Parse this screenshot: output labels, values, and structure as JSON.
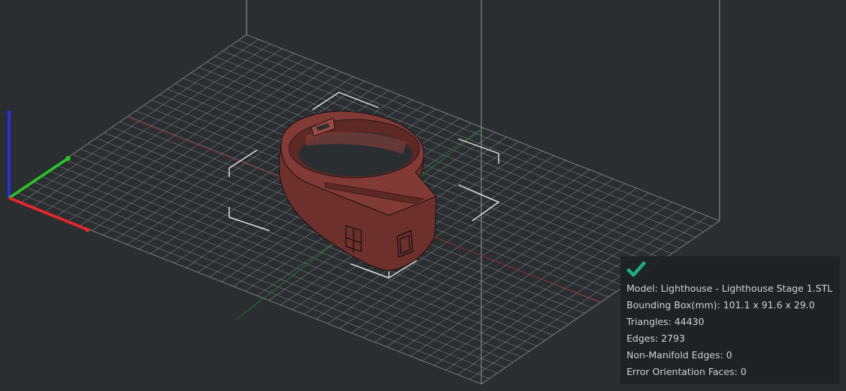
{
  "viewport": {
    "background": "#2b2e31",
    "grid_color": "#8a8d90",
    "model_color": "#7a3733",
    "axis_colors": {
      "x": "#e8262b",
      "y": "#27c427",
      "z": "#2a2ee6"
    },
    "icons": {
      "status": "checkmark-icon"
    }
  },
  "info_panel": {
    "status_color": "#1faa83",
    "lines": [
      "Model: Lighthouse - Lighthouse Stage 1.STL",
      "Bounding Box(mm): 101.1 x 91.6 x 29.0",
      "Triangles: 44430",
      "Edges: 2793",
      "Non-Manifold Edges: 0",
      "Error Orientation Faces: 0"
    ]
  }
}
